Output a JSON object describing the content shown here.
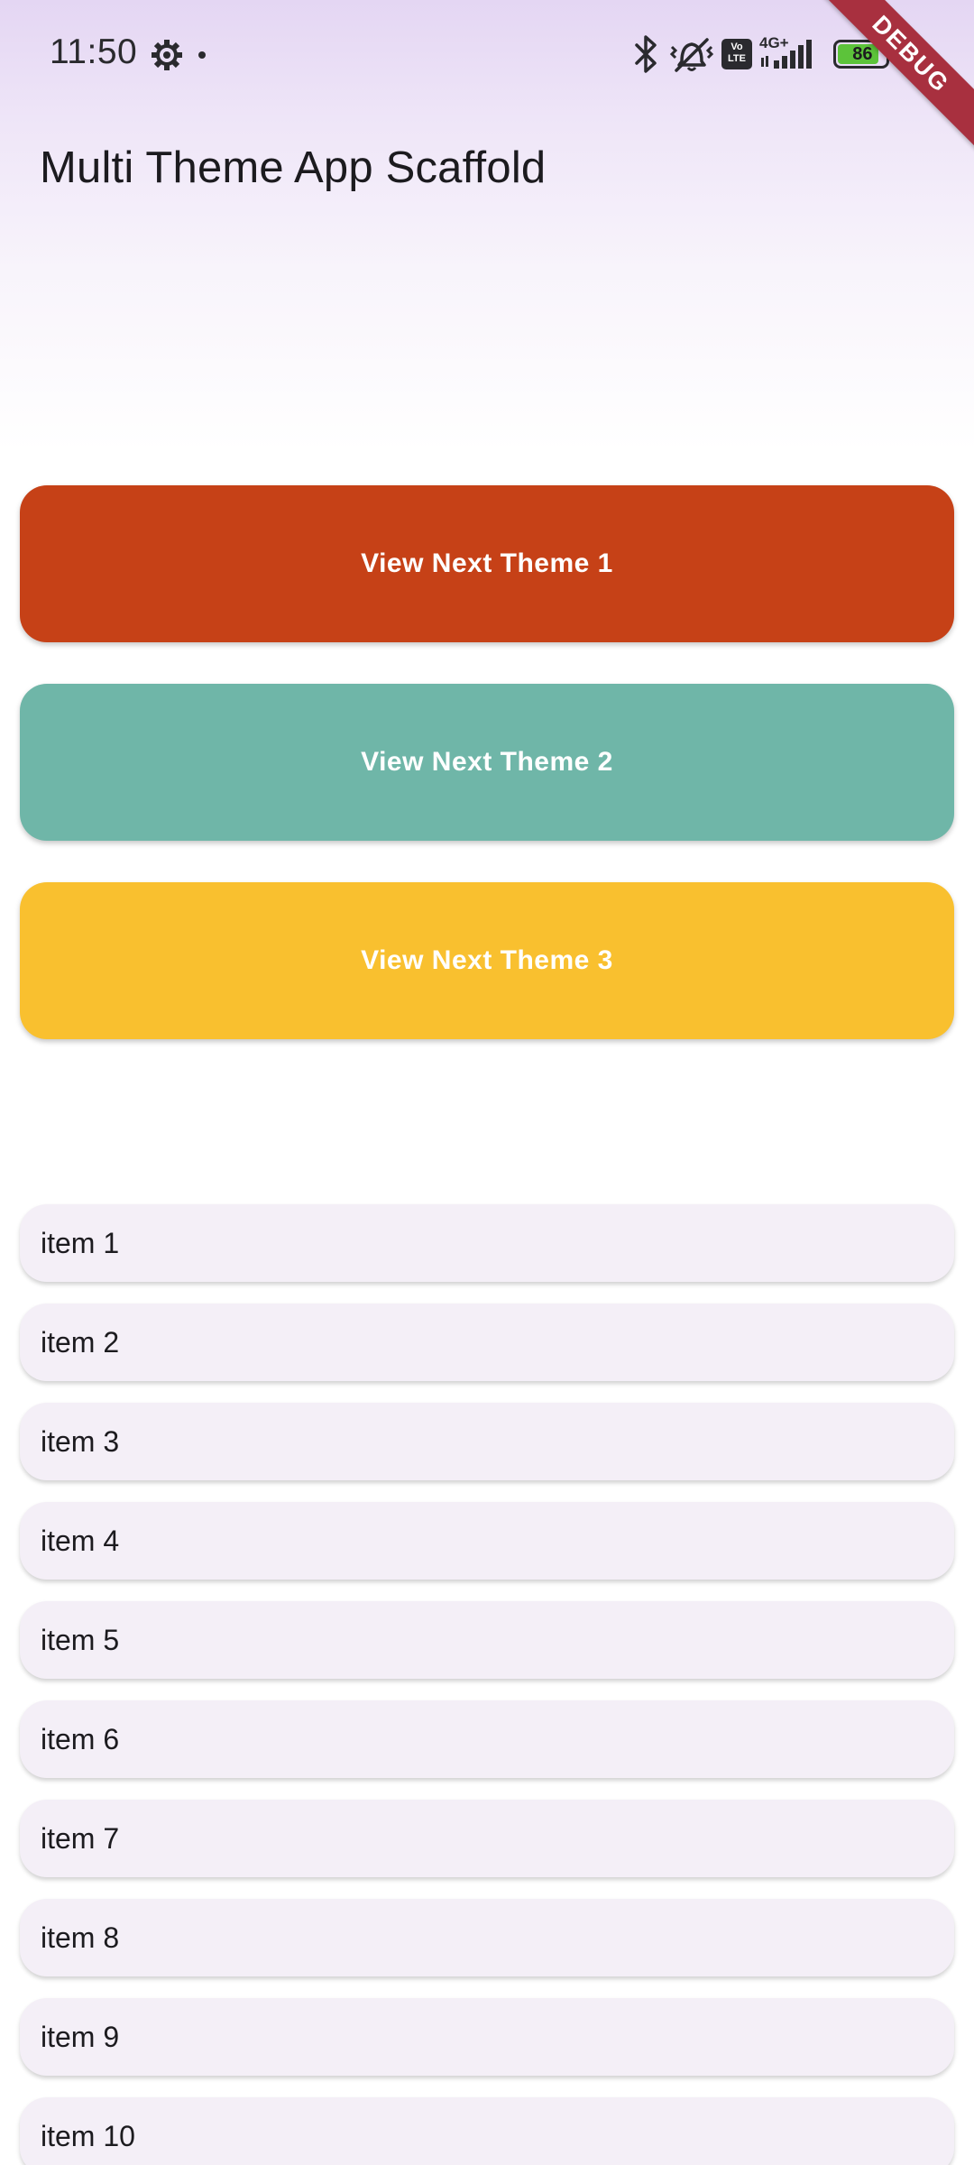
{
  "status_bar": {
    "time": "11:50",
    "battery_level": "86",
    "network_label": "4G+",
    "volte_label": "Vo LTE",
    "icons": [
      "settings-gear-icon",
      "notification-dot-icon",
      "bluetooth-icon",
      "vibrate-off-icon",
      "volte-icon",
      "signal-icon",
      "battery-icon"
    ]
  },
  "debug_banner": {
    "label": "DEBUG"
  },
  "app_bar": {
    "title": "Multi Theme App Scaffold"
  },
  "theme_buttons": [
    {
      "label": "View Next Theme 1",
      "color": "#c64117"
    },
    {
      "label": "View Next Theme 2",
      "color": "#6fb6a8"
    },
    {
      "label": "View Next Theme 3",
      "color": "#f9c02f"
    }
  ],
  "list": {
    "items": [
      "item 1",
      "item 2",
      "item 3",
      "item 4",
      "item 5",
      "item 6",
      "item 7",
      "item 8",
      "item 9",
      "item 10"
    ]
  },
  "colors": {
    "background_top": "#e4d6f3",
    "list_item_bg": "#f4eff7",
    "debug_banner": "#a8303f"
  }
}
